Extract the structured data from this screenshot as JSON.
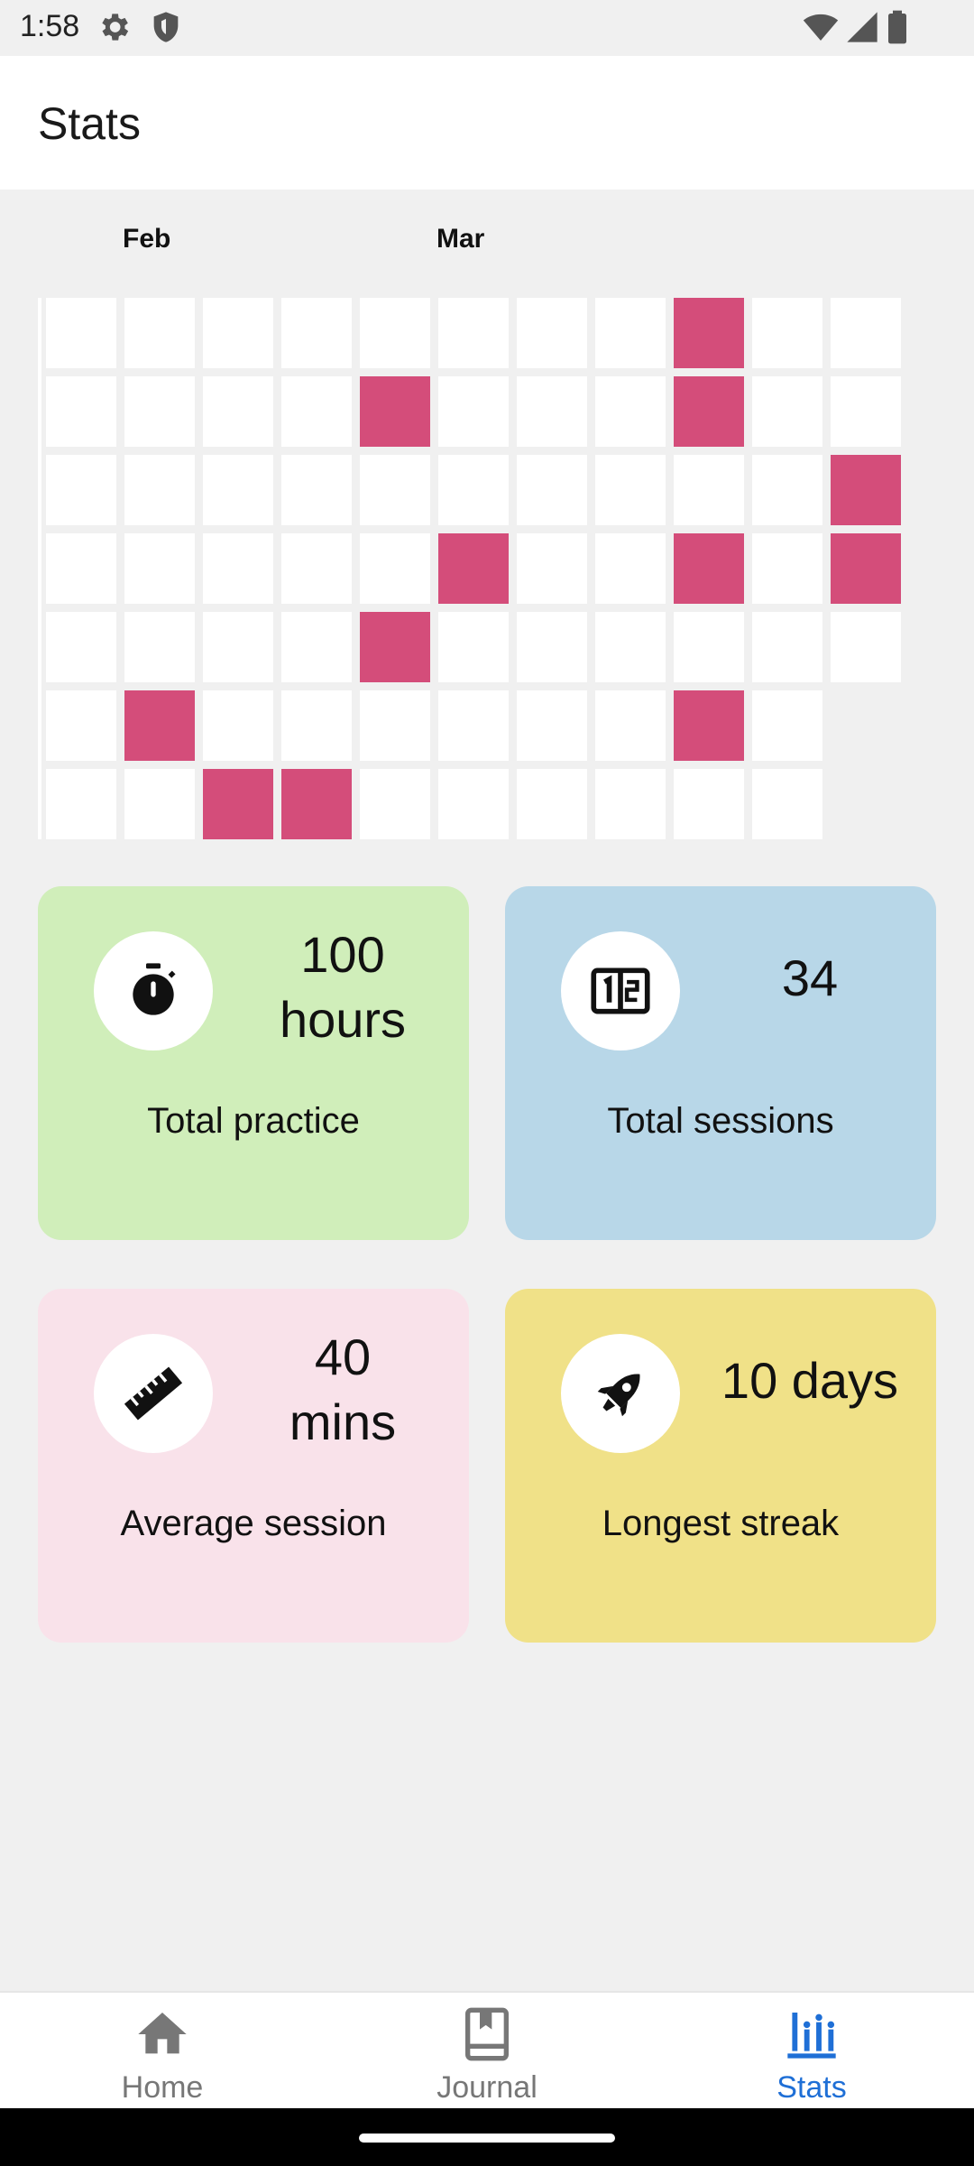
{
  "status_bar": {
    "time": "1:58",
    "icons": [
      "gear-icon",
      "shield-icon",
      "wifi-icon",
      "signal-icon",
      "battery-icon"
    ]
  },
  "app_bar": {
    "title": "Stats"
  },
  "heatmap": {
    "months": [
      "Feb",
      "Mar"
    ],
    "columns": 11,
    "rows": 7,
    "column_heights": [
      7,
      7,
      7,
      7,
      7,
      7,
      7,
      7,
      7,
      7,
      5
    ],
    "active_cells": [
      [
        0,
        8
      ],
      [
        1,
        4
      ],
      [
        1,
        8
      ],
      [
        2,
        10
      ],
      [
        3,
        5
      ],
      [
        3,
        8
      ],
      [
        3,
        10
      ],
      [
        4,
        4
      ],
      [
        5,
        1
      ],
      [
        5,
        8
      ],
      [
        6,
        2
      ],
      [
        6,
        3
      ]
    ],
    "active_color": "#d44d7a",
    "empty_color": "#ffffff"
  },
  "stats": [
    {
      "value_line1": "100",
      "value_line2": "hours",
      "label": "Total practice",
      "icon": "stopwatch-icon",
      "color": "#d0eeba"
    },
    {
      "value_line1": "34",
      "value_line2": "",
      "label": "Total sessions",
      "icon": "counter-icon",
      "color": "#b8d7e8"
    },
    {
      "value_line1": "40",
      "value_line2": "mins",
      "label": "Average session",
      "icon": "ruler-icon",
      "color": "#f9e2ea"
    },
    {
      "value_line1": "10 days",
      "value_line2": "",
      "label": "Longest streak",
      "icon": "rocket-icon",
      "color": "#f0e188"
    }
  ],
  "bottom_nav": {
    "items": [
      {
        "label": "Home",
        "icon": "home-icon",
        "active": false
      },
      {
        "label": "Journal",
        "icon": "journal-icon",
        "active": false
      },
      {
        "label": "Stats",
        "icon": "stats-icon",
        "active": true
      }
    ],
    "active_color": "#1f6fd6",
    "inactive_color": "#777777"
  }
}
